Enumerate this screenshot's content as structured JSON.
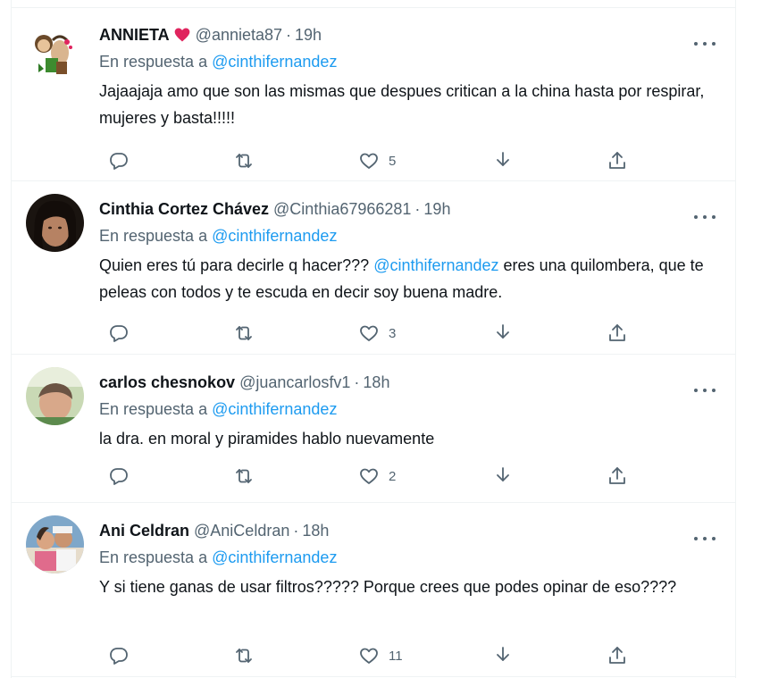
{
  "tweets": [
    {
      "display_name": "ANNIETA",
      "has_heart": true,
      "handle": "@annieta87",
      "time": "19h",
      "reply_prefix": "En respuesta a ",
      "reply_mention": "@cinthifernandez",
      "text_parts": [
        "Jajaajaja amo que son las mismas que despues critican a la china hasta por respirar, mujeres y basta!!!!!"
      ],
      "likes": "5"
    },
    {
      "display_name": "Cinthia Cortez Chávez",
      "has_heart": false,
      "handle": "@Cinthia67966281",
      "time": "19h",
      "reply_prefix": "En respuesta a ",
      "reply_mention": "@cinthifernandez",
      "text_before": "Quien eres tú para decirle q hacer??? ",
      "text_mention": "@cinthifernandez",
      "text_after": " eres una quilombera, que te peleas con todos y te escuda en decir soy buena madre.",
      "likes": "3"
    },
    {
      "display_name": "carlos chesnokov",
      "has_heart": false,
      "handle": "@juancarlosfv1",
      "time": "18h",
      "reply_prefix": "En respuesta a ",
      "reply_mention": "@cinthifernandez",
      "text_parts": [
        "la dra. en moral y piramides hablo nuevamente"
      ],
      "likes": "2"
    },
    {
      "display_name": "Ani Celdran",
      "has_heart": false,
      "handle": "@AniCeldran",
      "time": "18h",
      "reply_prefix": "En respuesta a ",
      "reply_mention": "@cinthifernandez",
      "text_parts": [
        "Y si tiene ganas de usar filtros????? Porque crees que podes opinar de eso????"
      ],
      "likes": "11"
    }
  ],
  "separator_dot": "·",
  "icons": {
    "reply": "reply-icon",
    "retweet": "retweet-icon",
    "like": "heart-icon",
    "download": "download-icon",
    "share": "share-icon",
    "more": "more-options-icon"
  },
  "colors": {
    "link": "#1d9bf0",
    "secondary_text": "#536471",
    "primary_text": "#0f1419",
    "heart": "#e0245e"
  }
}
